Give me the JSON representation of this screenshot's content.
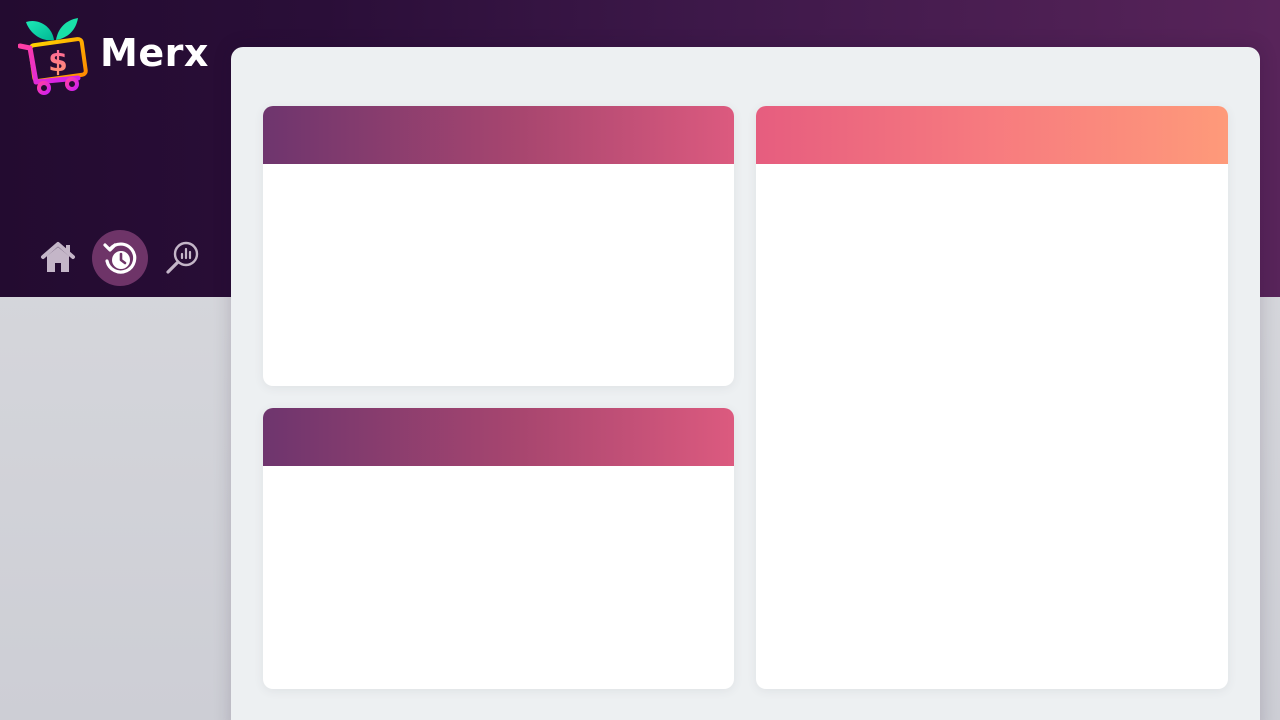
{
  "app": {
    "brand_name": "Merx",
    "logo_icon": "shopping-cart-dollar-logo-icon"
  },
  "nav": {
    "items": [
      {
        "id": "home",
        "icon": "home-icon",
        "active": false
      },
      {
        "id": "history",
        "icon": "history-clock-icon",
        "active": true
      },
      {
        "id": "analytics",
        "icon": "search-analytics-icon",
        "active": false
      }
    ]
  },
  "cards": [
    {
      "id": "card-top-left",
      "title": "",
      "header_style": "purple"
    },
    {
      "id": "card-bottom-left",
      "title": "",
      "header_style": "purple"
    },
    {
      "id": "card-right",
      "title": "",
      "header_style": "coral"
    }
  ],
  "colors": {
    "header_dark": "#230b30",
    "header_light": "#58245a",
    "nav_active": "#6e3468",
    "panel_bg": "#edf0f2",
    "purple_gradient_start": "#6e356e",
    "purple_gradient_end": "#dc5a7f",
    "coral_gradient_start": "#e65d7f",
    "coral_gradient_end": "#fe9a7a"
  }
}
